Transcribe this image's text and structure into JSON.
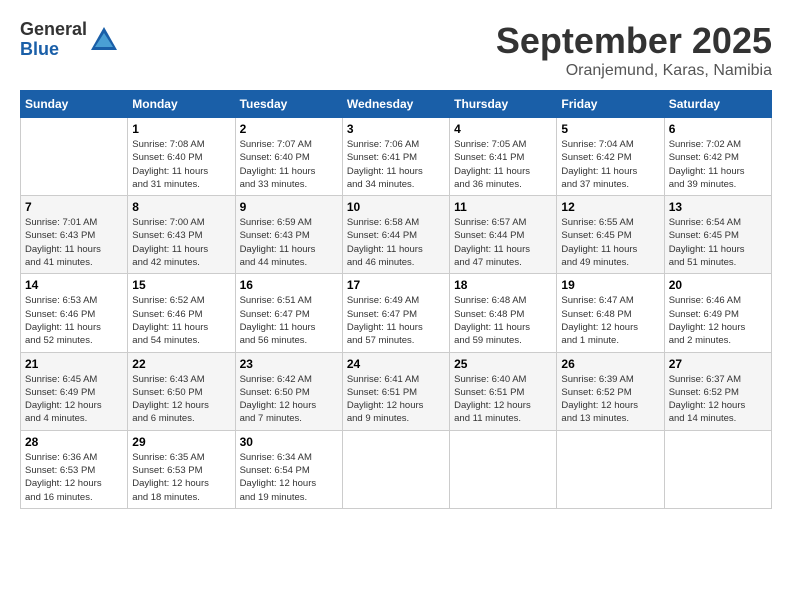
{
  "logo": {
    "general": "General",
    "blue": "Blue"
  },
  "title": "September 2025",
  "location": "Oranjemund, Karas, Namibia",
  "days_of_week": [
    "Sunday",
    "Monday",
    "Tuesday",
    "Wednesday",
    "Thursday",
    "Friday",
    "Saturday"
  ],
  "weeks": [
    [
      {
        "day": "",
        "info": ""
      },
      {
        "day": "1",
        "info": "Sunrise: 7:08 AM\nSunset: 6:40 PM\nDaylight: 11 hours\nand 31 minutes."
      },
      {
        "day": "2",
        "info": "Sunrise: 7:07 AM\nSunset: 6:40 PM\nDaylight: 11 hours\nand 33 minutes."
      },
      {
        "day": "3",
        "info": "Sunrise: 7:06 AM\nSunset: 6:41 PM\nDaylight: 11 hours\nand 34 minutes."
      },
      {
        "day": "4",
        "info": "Sunrise: 7:05 AM\nSunset: 6:41 PM\nDaylight: 11 hours\nand 36 minutes."
      },
      {
        "day": "5",
        "info": "Sunrise: 7:04 AM\nSunset: 6:42 PM\nDaylight: 11 hours\nand 37 minutes."
      },
      {
        "day": "6",
        "info": "Sunrise: 7:02 AM\nSunset: 6:42 PM\nDaylight: 11 hours\nand 39 minutes."
      }
    ],
    [
      {
        "day": "7",
        "info": "Sunrise: 7:01 AM\nSunset: 6:43 PM\nDaylight: 11 hours\nand 41 minutes."
      },
      {
        "day": "8",
        "info": "Sunrise: 7:00 AM\nSunset: 6:43 PM\nDaylight: 11 hours\nand 42 minutes."
      },
      {
        "day": "9",
        "info": "Sunrise: 6:59 AM\nSunset: 6:43 PM\nDaylight: 11 hours\nand 44 minutes."
      },
      {
        "day": "10",
        "info": "Sunrise: 6:58 AM\nSunset: 6:44 PM\nDaylight: 11 hours\nand 46 minutes."
      },
      {
        "day": "11",
        "info": "Sunrise: 6:57 AM\nSunset: 6:44 PM\nDaylight: 11 hours\nand 47 minutes."
      },
      {
        "day": "12",
        "info": "Sunrise: 6:55 AM\nSunset: 6:45 PM\nDaylight: 11 hours\nand 49 minutes."
      },
      {
        "day": "13",
        "info": "Sunrise: 6:54 AM\nSunset: 6:45 PM\nDaylight: 11 hours\nand 51 minutes."
      }
    ],
    [
      {
        "day": "14",
        "info": "Sunrise: 6:53 AM\nSunset: 6:46 PM\nDaylight: 11 hours\nand 52 minutes."
      },
      {
        "day": "15",
        "info": "Sunrise: 6:52 AM\nSunset: 6:46 PM\nDaylight: 11 hours\nand 54 minutes."
      },
      {
        "day": "16",
        "info": "Sunrise: 6:51 AM\nSunset: 6:47 PM\nDaylight: 11 hours\nand 56 minutes."
      },
      {
        "day": "17",
        "info": "Sunrise: 6:49 AM\nSunset: 6:47 PM\nDaylight: 11 hours\nand 57 minutes."
      },
      {
        "day": "18",
        "info": "Sunrise: 6:48 AM\nSunset: 6:48 PM\nDaylight: 11 hours\nand 59 minutes."
      },
      {
        "day": "19",
        "info": "Sunrise: 6:47 AM\nSunset: 6:48 PM\nDaylight: 12 hours\nand 1 minute."
      },
      {
        "day": "20",
        "info": "Sunrise: 6:46 AM\nSunset: 6:49 PM\nDaylight: 12 hours\nand 2 minutes."
      }
    ],
    [
      {
        "day": "21",
        "info": "Sunrise: 6:45 AM\nSunset: 6:49 PM\nDaylight: 12 hours\nand 4 minutes."
      },
      {
        "day": "22",
        "info": "Sunrise: 6:43 AM\nSunset: 6:50 PM\nDaylight: 12 hours\nand 6 minutes."
      },
      {
        "day": "23",
        "info": "Sunrise: 6:42 AM\nSunset: 6:50 PM\nDaylight: 12 hours\nand 7 minutes."
      },
      {
        "day": "24",
        "info": "Sunrise: 6:41 AM\nSunset: 6:51 PM\nDaylight: 12 hours\nand 9 minutes."
      },
      {
        "day": "25",
        "info": "Sunrise: 6:40 AM\nSunset: 6:51 PM\nDaylight: 12 hours\nand 11 minutes."
      },
      {
        "day": "26",
        "info": "Sunrise: 6:39 AM\nSunset: 6:52 PM\nDaylight: 12 hours\nand 13 minutes."
      },
      {
        "day": "27",
        "info": "Sunrise: 6:37 AM\nSunset: 6:52 PM\nDaylight: 12 hours\nand 14 minutes."
      }
    ],
    [
      {
        "day": "28",
        "info": "Sunrise: 6:36 AM\nSunset: 6:53 PM\nDaylight: 12 hours\nand 16 minutes."
      },
      {
        "day": "29",
        "info": "Sunrise: 6:35 AM\nSunset: 6:53 PM\nDaylight: 12 hours\nand 18 minutes."
      },
      {
        "day": "30",
        "info": "Sunrise: 6:34 AM\nSunset: 6:54 PM\nDaylight: 12 hours\nand 19 minutes."
      },
      {
        "day": "",
        "info": ""
      },
      {
        "day": "",
        "info": ""
      },
      {
        "day": "",
        "info": ""
      },
      {
        "day": "",
        "info": ""
      }
    ]
  ]
}
